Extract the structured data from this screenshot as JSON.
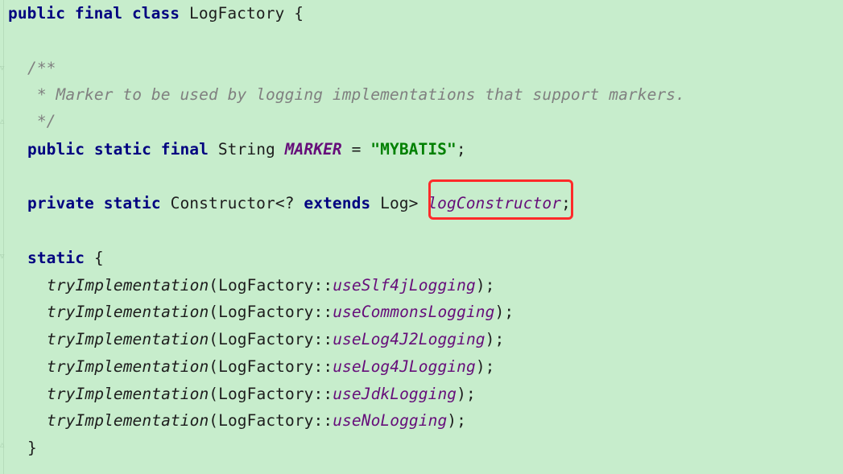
{
  "colors": {
    "background": "#c7edcc",
    "keyword": "#000080",
    "comment": "#808080",
    "field": "#660e7a",
    "string": "#008000",
    "highlight_box": "#ff2a2a"
  },
  "code": {
    "line1": {
      "kw1": "public",
      "kw2": "final",
      "kw3": "class",
      "name": "LogFactory",
      "brace": "{"
    },
    "comment_open": "/**",
    "comment_body": " * Marker to be used by logging implementations that support markers.",
    "comment_close": " */",
    "marker_line": {
      "kw1": "public",
      "kw2": "static",
      "kw3": "final",
      "type": "String",
      "name": "MARKER",
      "eq": "=",
      "value": "\"MYBATIS\"",
      "semi": ";"
    },
    "ctor_line": {
      "kw1": "private",
      "kw2": "static",
      "type_start": "Constructor<?",
      "kw3": "extends",
      "type_end": "Log>",
      "name": "logConstructor",
      "semi": ";"
    },
    "static_line": {
      "kw": "static",
      "brace": "{"
    },
    "try_method": "tryImplementation",
    "calls": [
      {
        "prefix": "(LogFactory::",
        "method": "useSlf4jLogging",
        "suffix": ");"
      },
      {
        "prefix": "(LogFactory::",
        "method": "useCommonsLogging",
        "suffix": ");"
      },
      {
        "prefix": "(LogFactory::",
        "method": "useLog4J2Logging",
        "suffix": ");"
      },
      {
        "prefix": "(LogFactory::",
        "method": "useLog4JLogging",
        "suffix": ");"
      },
      {
        "prefix": "(LogFactory::",
        "method": "useJdkLogging",
        "suffix": ");"
      },
      {
        "prefix": "(LogFactory::",
        "method": "useNoLogging",
        "suffix": ");"
      }
    ],
    "close_brace": "}"
  },
  "icons": [
    "fold-marker-icon"
  ]
}
